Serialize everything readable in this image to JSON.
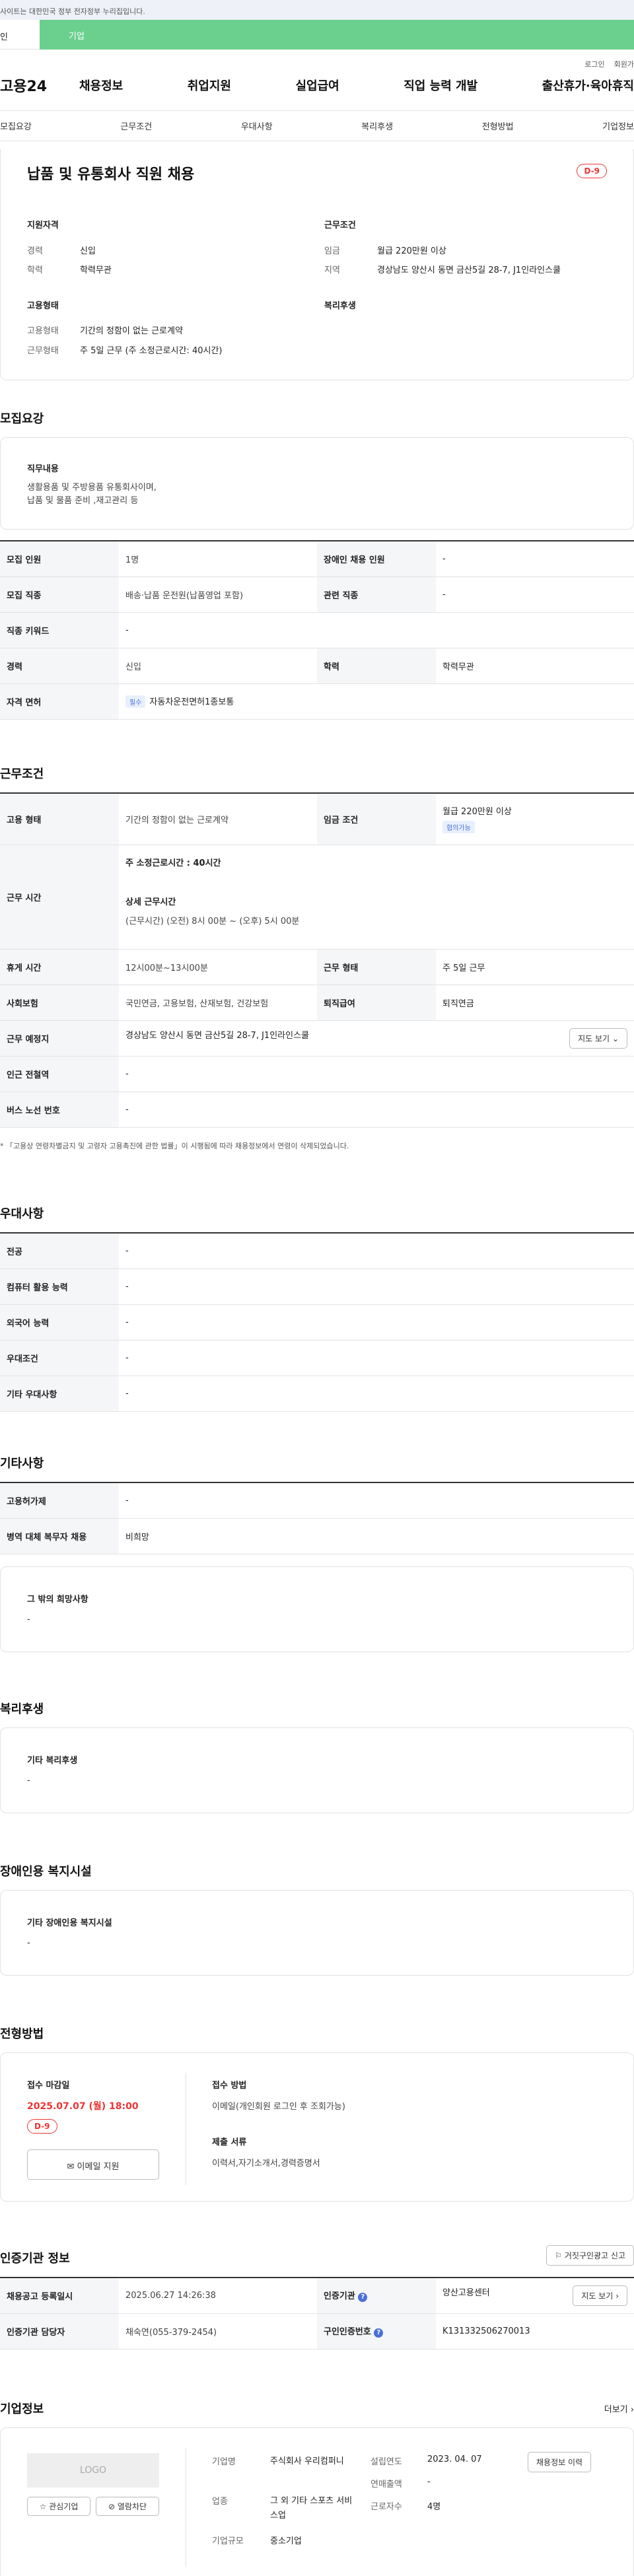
{
  "topbar": {
    "notice": "사이트는 대한민국 정부 전자정부 누리집입니다."
  },
  "tabs": {
    "personal": "인",
    "company": "기업"
  },
  "util": {
    "login": "로그인",
    "join": "회원가"
  },
  "gnb": {
    "logo": "고용24",
    "menu": [
      "채용정보",
      "취업지원",
      "실업급여",
      "직업 능력 개발",
      "출산휴가·육아휴직"
    ]
  },
  "subnav": [
    "모집요강",
    "근무조건",
    "우대사항",
    "복리후생",
    "전형방법",
    "기업정보"
  ],
  "job": {
    "title": "납품 및 유통회사 직원 채용",
    "dday": "D-9",
    "qual_head": "지원자격",
    "cond_head": "근무조건",
    "career_label": "경력",
    "career": "신입",
    "edu_label": "학력",
    "edu": "학력무관",
    "wage_label": "임금",
    "wage": "월급 220만원 이상",
    "loc_label": "지역",
    "loc": "경상남도 양산시 동면 금산5길 28-7, J1인라인스쿨",
    "type_head": "고용형태",
    "welfare_head": "복리후생",
    "emp_label": "고용형태",
    "emp": "기간의 정함이 없는 근로계약",
    "work_label": "근무형태",
    "work": "주 5일 근무 (주 소정근로시간: 40시간)"
  },
  "recruit": {
    "heading": "모집요강",
    "duty_head": "직무내용",
    "duty_text": "생활용품 및 주방용품 유통회사이며,\n납품 및 물품 준비 ,재고관리 등",
    "rows": [
      {
        "k1": "모집 인원",
        "v1": "1명",
        "k2": "장애인 채용 인원",
        "v2": "-"
      },
      {
        "k1": "모집 직종",
        "v1": "배송·납품 운전원(납품영업 포함)",
        "k2": "관련 직종",
        "v2": "-"
      },
      {
        "k1": "직종 키워드",
        "v1": "-"
      },
      {
        "k1": "경력",
        "v1": "신입",
        "k2": "학력",
        "v2": "학력무관"
      },
      {
        "k1": "자격 면허",
        "pill": "필수",
        "v1": "자동차운전면허1종보통"
      }
    ]
  },
  "conditions": {
    "heading": "근무조건",
    "emp_k": "고용 형태",
    "emp_v": "기간의 정함이 없는 근로계약",
    "wage_k": "임금 조건",
    "wage_v": "월급 220만원 이상",
    "wage_pill": "협의가능",
    "time_k": "근무 시간",
    "time_main": "주 소정근로시간 : 40시간",
    "time_sub_head": "상세 근무시간",
    "time_sub": "(근무시간) (오전) 8시 00분 ~ (오후) 5시 00분",
    "rest_k": "휴게 시간",
    "rest_v": "12시00분~13시00분",
    "form_k": "근무 형태",
    "form_v": "주 5일 근무",
    "ins_k": "사회보험",
    "ins_v": "국민연금, 고용보험, 산재보험, 건강보험",
    "ret_k": "퇴직급여",
    "ret_v": "퇴직연금",
    "place_k": "근무 예정지",
    "place_v": "경상남도 양산시 동면 금산5길 28-7, J1인라인스쿨",
    "map_btn": "지도 보기",
    "subway_k": "인근 전철역",
    "subway_v": "-",
    "bus_k": "버스 노선 번호",
    "bus_v": "-",
    "note": "「고용상 연령차별금지 및 고령자 고용촉진에 관한 법률」이 시행됨에 따라 채용정보에서 연령이 삭제되었습니다."
  },
  "pref": {
    "heading": "우대사항",
    "rows": [
      [
        "전공",
        "-"
      ],
      [
        "컴퓨터 활용 능력",
        "-"
      ],
      [
        "외국어 능력",
        "-"
      ],
      [
        "우대조건",
        "-"
      ],
      [
        "기타 우대사항",
        "-"
      ]
    ]
  },
  "etc": {
    "heading": "기타사항",
    "rows": [
      [
        "고용허가제",
        "-"
      ],
      [
        "병역 대체 복무자 채용",
        "비희망"
      ]
    ],
    "box_head": "그 밖의 희망사항",
    "box_val": "-"
  },
  "welfare": {
    "heading": "복리후생",
    "box_head": "기타 복리후생",
    "box_val": "-"
  },
  "disabled": {
    "heading": "장애인용 복지시설",
    "box_head": "기타 장애인용 복지시설",
    "box_val": "-"
  },
  "process": {
    "heading": "전형방법",
    "deadline_head": "접수 마감일",
    "deadline": "2025.07.07 (월) 18:00",
    "dday": "D-9",
    "email_btn": "이메일 지원",
    "method_head": "접수 방법",
    "method": "이메일(개인회원 로그인 후 조회가능)",
    "docs_head": "제출 서류",
    "docs": "이력서,자기소개서,경력증명서"
  },
  "agency": {
    "heading": "인증기관 정보",
    "report_btn": "거짓구인광고 신고",
    "reg_k": "채용공고 등록일시",
    "reg_v": "2025.06.27 14:26:38",
    "org_k": "인증기관",
    "org_v": "양산고용센터",
    "org_btn": "지도 보기",
    "mgr_k": "인증기관 담당자",
    "mgr_v": "채숙연(055-379-2454)",
    "num_k": "구인인증번호",
    "num_v": "K131332506270013"
  },
  "company": {
    "heading": "기업정보",
    "more": "더보기",
    "logo": "LOGO",
    "fav_btn": "관심기업",
    "block_btn": "열람차단",
    "name_k": "기업명",
    "name_v": "주식회사 우리컴퍼니",
    "ind_k": "업종",
    "ind_v": "그 외 기타 스포츠 서비스업",
    "size_k": "기업규모",
    "size_v": "중소기업",
    "year_k": "설립연도",
    "year_v": "2023. 04. 07",
    "sales_k": "연매출액",
    "sales_v": "-",
    "emp_k": "근로자수",
    "emp_v": "4명",
    "history_btn": "채용정보 이력"
  }
}
